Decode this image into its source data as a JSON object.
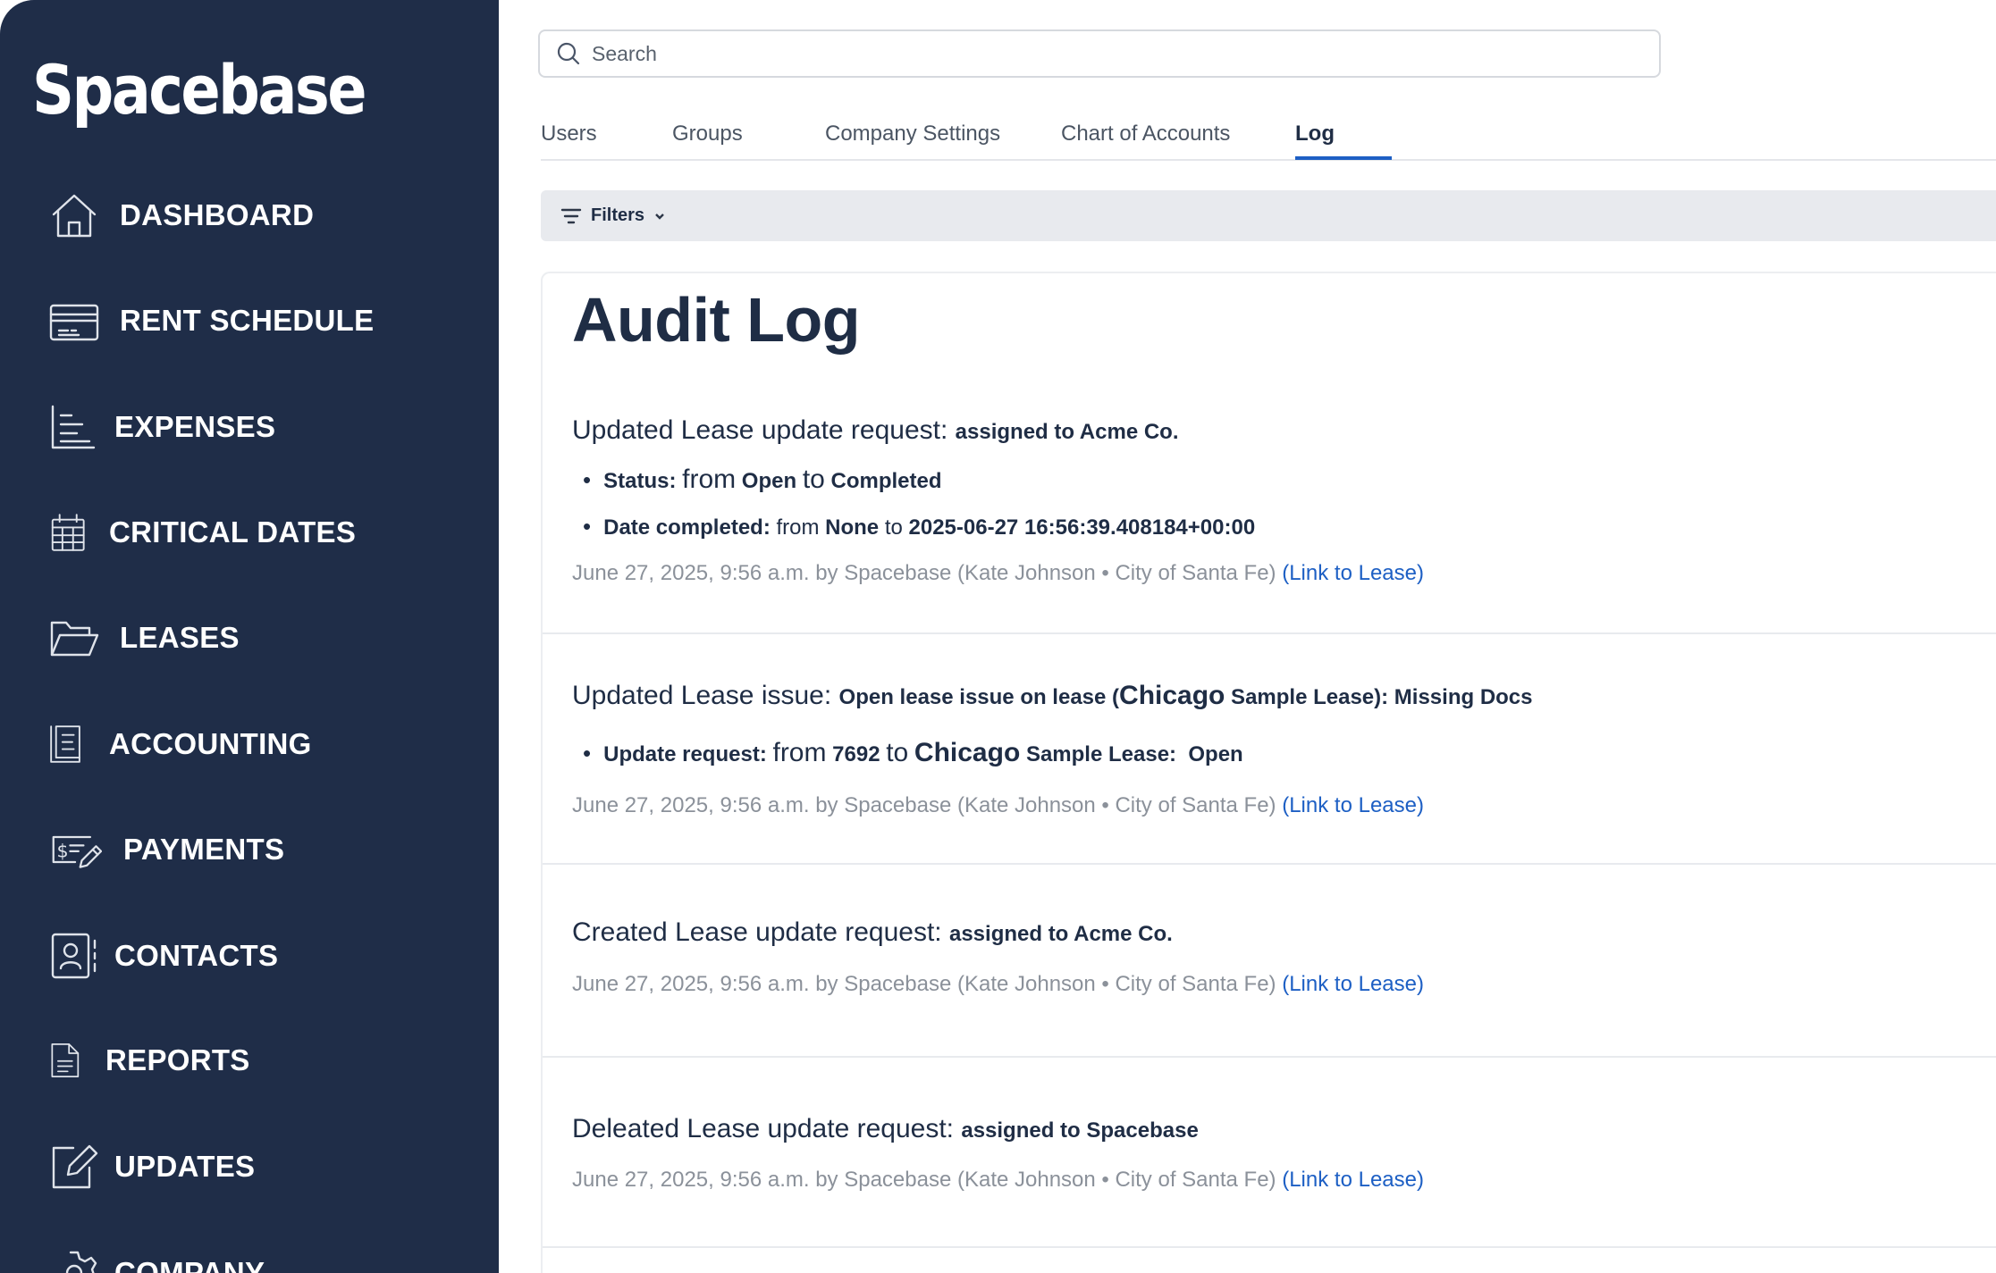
{
  "sidebar": {
    "logo": "Spacebase",
    "items": [
      {
        "label": "DASHBOARD",
        "icon": "home-icon"
      },
      {
        "label": "RENT SCHEDULE",
        "icon": "credit-card-icon"
      },
      {
        "label": "EXPENSES",
        "icon": "bar-chart-icon"
      },
      {
        "label": "CRITICAL DATES",
        "icon": "calendar-icon"
      },
      {
        "label": "LEASES",
        "icon": "folder-open-icon"
      },
      {
        "label": "ACCOUNTING",
        "icon": "ledger-icon"
      },
      {
        "label": "PAYMENTS",
        "icon": "payment-check-icon"
      },
      {
        "label": "CONTACTS",
        "icon": "contact-book-icon"
      },
      {
        "label": "REPORTS",
        "icon": "document-icon"
      },
      {
        "label": "UPDATES",
        "icon": "edit-icon"
      },
      {
        "label": "COMPANY",
        "icon": "gear-icon"
      }
    ]
  },
  "search": {
    "placeholder": "Search"
  },
  "tabs": [
    {
      "label": "Users"
    },
    {
      "label": "Groups"
    },
    {
      "label": "Company Settings"
    },
    {
      "label": "Chart of Accounts"
    },
    {
      "label": "Log",
      "active": true
    }
  ],
  "filters": {
    "label": "Filters"
  },
  "audit": {
    "title": "Audit Log",
    "entries": [
      {
        "action": "Updated Lease update request:",
        "detail": "assigned to Acme Co.",
        "changes": [
          {
            "field": "Status:",
            "from_word": "from",
            "from": "Open",
            "to_word": "to",
            "to": "Completed"
          },
          {
            "field": "Date completed:",
            "from_word": "from",
            "from": "None",
            "to_word": "to",
            "to": "2025-06-27 16:56:39.408184+00:00"
          }
        ],
        "meta": "June 27, 2025, 9:56 a.m. by Spacebase (Kate Johnson • City of Santa Fe)",
        "link": "(Link to Lease)"
      },
      {
        "action": "Updated Lease issue:",
        "detail_pre": "Open lease issue on lease (",
        "detail_city": "Chicago",
        "detail_post": " Sample Lease): Missing Docs",
        "changes": [
          {
            "field": "Update request:",
            "from_word": "from",
            "from": "7692",
            "to_word": "to",
            "to_city": "Chicago",
            "to": " Sample Lease:  Open"
          }
        ],
        "meta": "June 27, 2025, 9:56 a.m. by Spacebase (Kate Johnson • City of Santa Fe)",
        "link": "(Link to Lease)"
      },
      {
        "action": "Created Lease update request:",
        "detail": "assigned to Acme Co.",
        "meta": "June 27, 2025, 9:56 a.m. by Spacebase (Kate Johnson • City of Santa Fe)",
        "link": "(Link to Lease)"
      },
      {
        "action": "Deleated Lease update request:",
        "detail": "assigned to Spacebase",
        "meta": "June 27, 2025, 9:56 a.m. by Spacebase (Kate Johnson • City of Santa Fe)",
        "link": "(Link to Lease)"
      }
    ]
  }
}
